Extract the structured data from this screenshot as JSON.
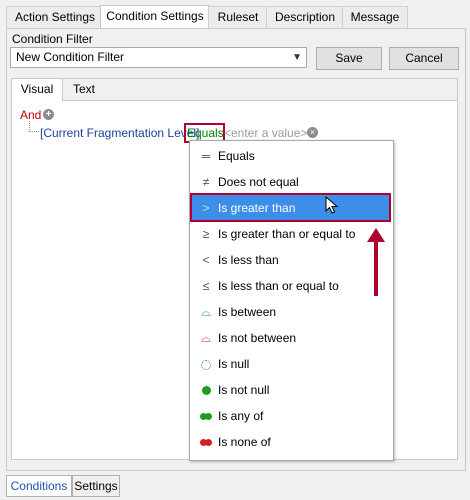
{
  "tabs": [
    "Action Settings",
    "Condition Settings",
    "Ruleset",
    "Description",
    "Message"
  ],
  "active_tab": "Condition Settings",
  "condition_filter": {
    "label": "Condition Filter",
    "value": "New Condition Filter",
    "save": "Save",
    "cancel": "Cancel"
  },
  "editor_tabs": [
    "Visual",
    "Text"
  ],
  "expression": {
    "group": "And",
    "field": "[Current Fragmentation Level]",
    "operator": "Equals",
    "value_placeholder": "<enter a value>"
  },
  "operators": [
    {
      "label": "Equals",
      "icon": "equals-icon"
    },
    {
      "label": "Does not equal",
      "icon": "not-equal-icon"
    },
    {
      "label": "Is greater than",
      "icon": "greater-than-icon",
      "selected": true
    },
    {
      "label": "Is greater than or equal to",
      "icon": "greater-equal-icon"
    },
    {
      "label": "Is less than",
      "icon": "less-than-icon"
    },
    {
      "label": "Is less than or equal to",
      "icon": "less-equal-icon"
    },
    {
      "label": "Is between",
      "icon": "between-icon"
    },
    {
      "label": "Is not between",
      "icon": "not-between-icon"
    },
    {
      "label": "Is null",
      "icon": "null-icon"
    },
    {
      "label": "Is not null",
      "icon": "not-null-icon"
    },
    {
      "label": "Is any of",
      "icon": "any-of-icon"
    },
    {
      "label": "Is none of",
      "icon": "none-of-icon"
    }
  ],
  "bottom_tabs": [
    "Conditions",
    "Settings"
  ],
  "colors": {
    "highlight": "#b0002e",
    "selection": "#3d8ee8",
    "green": "#1aa01a",
    "red": "#d02020"
  }
}
